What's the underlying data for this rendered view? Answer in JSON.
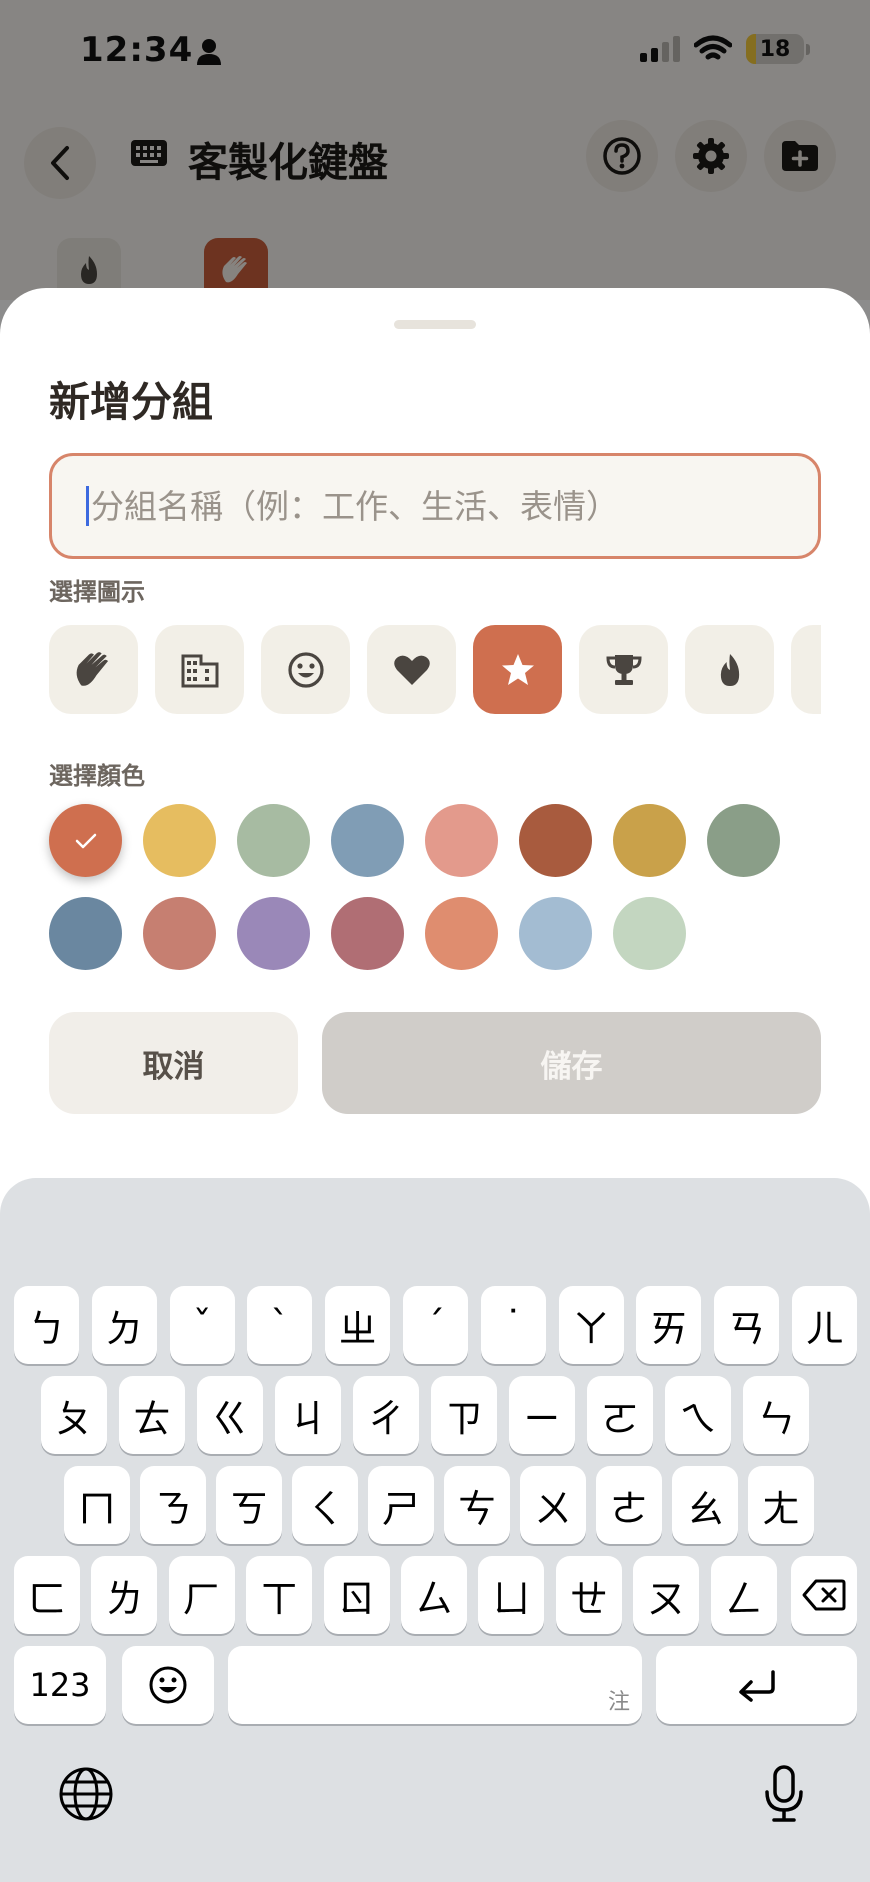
{
  "status": {
    "time": "12:34",
    "battery": "18",
    "battery_level": 0.18
  },
  "header": {
    "title": "客製化鍵盤",
    "back_icon": "chevron-left-icon",
    "title_icon": "keyboard-icon",
    "actions": [
      "help-icon",
      "gear-icon",
      "folder-add-icon"
    ]
  },
  "sheet": {
    "title": "新增分組",
    "name_input": {
      "value": "",
      "placeholder": "分組名稱（例：工作、生活、表情）"
    },
    "icon_label": "選擇圖示",
    "icons": [
      "wave-icon",
      "building-icon",
      "smile-icon",
      "heart-icon",
      "star-icon",
      "trophy-icon",
      "fire-icon",
      "more-icon"
    ],
    "selected_icon": "star-icon",
    "color_label": "選擇顏色",
    "colors_row1": [
      "#cf6f4f",
      "#e6bd60",
      "#a7bba2",
      "#809db5",
      "#e39a8c",
      "#a85b3e",
      "#c9a14a",
      "#8a9e88"
    ],
    "colors_row2": [
      "#6a87a0",
      "#c67f71",
      "#9a88b8",
      "#b06e74",
      "#df8d6f",
      "#a3bcd2",
      "#c3d6c0"
    ],
    "selected_color": "#cf6f4f",
    "cancel_label": "取消",
    "save_label": "儲存"
  },
  "keyboard": {
    "row1": [
      "ㄅ",
      "ㄉ",
      "ˇ",
      "ˋ",
      "ㄓ",
      "ˊ",
      "˙",
      "ㄚ",
      "ㄞ",
      "ㄢ",
      "ㄦ"
    ],
    "row2": [
      "ㄆ",
      "ㄊ",
      "ㄍ",
      "ㄐ",
      "ㄔ",
      "ㄗ",
      "ㄧ",
      "ㄛ",
      "ㄟ",
      "ㄣ"
    ],
    "row3": [
      "ㄇ",
      "ㄋ",
      "ㄎ",
      "ㄑ",
      "ㄕ",
      "ㄘ",
      "ㄨ",
      "ㄜ",
      "ㄠ",
      "ㄤ"
    ],
    "row4": [
      "ㄈ",
      "ㄌ",
      "ㄏ",
      "ㄒ",
      "ㄖ",
      "ㄙ",
      "ㄩ",
      "ㄝ",
      "ㄡ",
      "ㄥ"
    ],
    "numbers_label": "123",
    "space_hint": "注",
    "emoji_icon": "emoji-icon",
    "return_icon": "return-icon",
    "delete_icon": "delete-icon",
    "globe_icon": "globe-icon",
    "mic_icon": "microphone-icon"
  }
}
